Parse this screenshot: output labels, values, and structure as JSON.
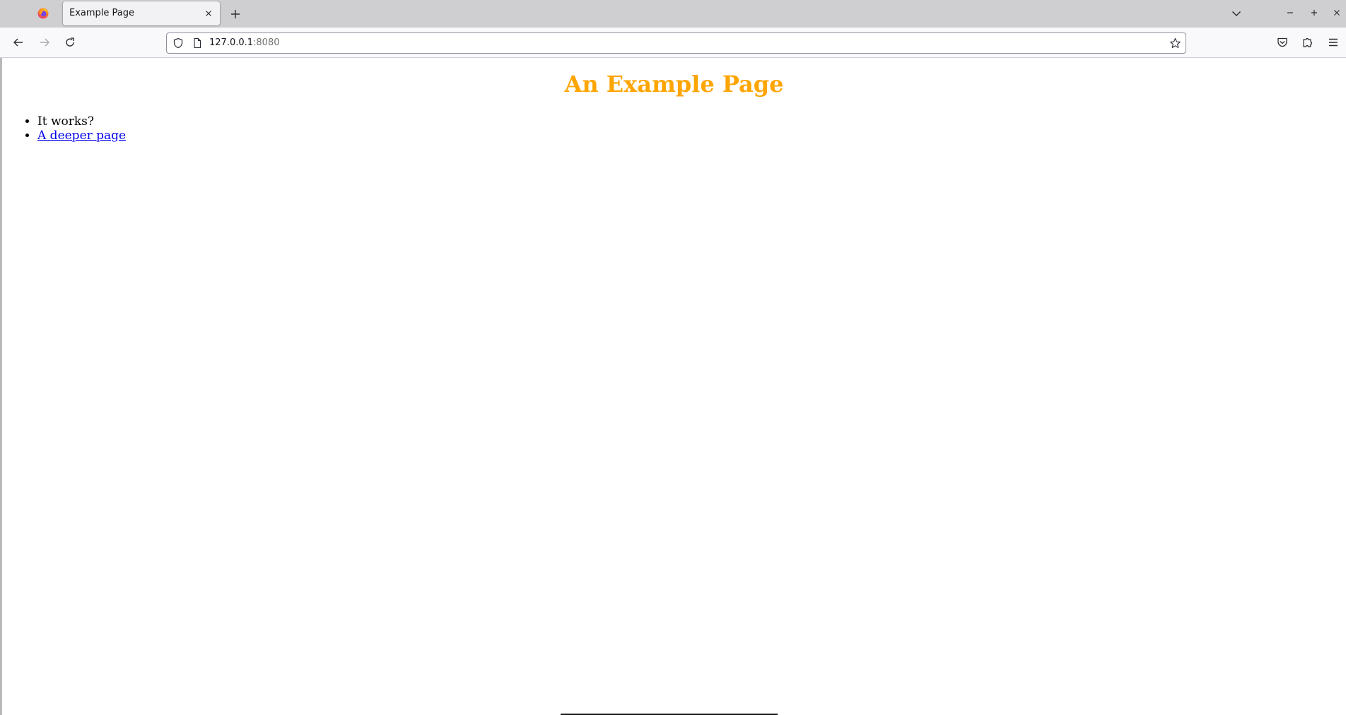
{
  "browser": {
    "tabs": [
      {
        "title": "Example Page",
        "active": true
      }
    ],
    "url": {
      "host": "127.0.0.1",
      "port": ":8080"
    },
    "icons": {
      "app": "firefox-logo",
      "tab_close": "close-icon",
      "new_tab": "plus-icon",
      "tab_list": "chevron-down-icon",
      "back": "arrow-left-icon",
      "forward": "arrow-right-icon",
      "reload": "reload-icon",
      "site_security": "shield-icon",
      "page": "page-icon",
      "bookmark": "star-icon",
      "pocket": "pocket-icon",
      "extensions": "puzzle-icon",
      "menu": "hamburger-icon",
      "minimize": "minimize-icon",
      "maximize": "maximize-icon",
      "close_window": "close-icon"
    }
  },
  "page": {
    "heading": "An Example Page",
    "heading_color": "#ffa500",
    "list_items": [
      {
        "text": "It works?",
        "link": false
      },
      {
        "text": "A deeper page",
        "link": true
      }
    ],
    "link_color": "#0000ee"
  }
}
